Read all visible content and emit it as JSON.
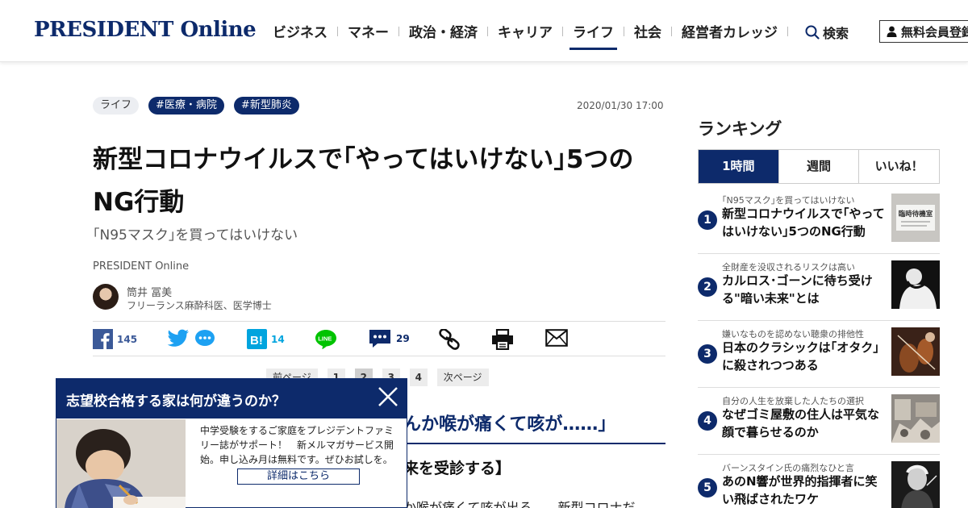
{
  "header": {
    "logo": "PRESIDENT Online",
    "nav": [
      "ビジネス",
      "マネー",
      "政治・経済",
      "キャリア",
      "ライフ",
      "社会",
      "経営者カレッジ"
    ],
    "active_nav": "ライフ",
    "search_label": "検索",
    "member_label": "無料会員登録"
  },
  "article": {
    "tags": [
      "ライフ",
      "#医療・病院",
      "#新型肺炎"
    ],
    "date": "2020/01/30 17:00",
    "title": "新型コロナウイルスで｢やってはいけない｣5つのNG行動",
    "subtitle": "｢N95マスク｣を買ってはいけない",
    "publisher": "PRESIDENT Online",
    "author": {
      "name": "筒井 冨美",
      "role": "フリーランス麻酔科医、医学博士"
    },
    "share": {
      "facebook_count": "145",
      "hatena_count": "14",
      "comment_count": "29"
    },
    "pager": {
      "prev": "前ページ",
      "pages": [
        "1",
        "2",
        "3",
        "4"
      ],
      "current": "2",
      "next": "次ページ"
    },
    "partial_heading": "んか喉が痛くて咳が……」",
    "partial_subheading": "来を受診する】",
    "partial_body": "か喉が痛くて咳が出る……新型コロナだ"
  },
  "popup": {
    "title": "志望校合格する家は何が違うのか？",
    "text": "中学受験をするご家庭をプレジデントファミリー誌がサポート！　新メルマガサービス開始。申し込み月は無料です。ぜひお試しを。",
    "button": "詳細はこちら"
  },
  "ranking": {
    "title": "ランキング",
    "tabs": [
      "1時間",
      "週間",
      "いいね！"
    ],
    "active_tab": "1時間",
    "items": [
      {
        "num": "1",
        "kicker": "｢N95マスク｣を買ってはいけない",
        "headline": "新型コロナウイルスで｢やってはいけない｣5つのNG行動",
        "thumb_label": "臨時待機室"
      },
      {
        "num": "2",
        "kicker": "全財産を没収されるリスクは高い",
        "headline": "カルロス･ゴーンに待ち受ける\"暗い未来\"とは"
      },
      {
        "num": "3",
        "kicker": "嫌いなものを認めない聴衆の排他性",
        "headline": "日本のクラシックは｢オタク｣に殺されつつある"
      },
      {
        "num": "4",
        "kicker": "自分の人生を放棄した人たちの選択",
        "headline": "なぜゴミ屋敷の住人は平気な顔で暮らせるのか"
      },
      {
        "num": "5",
        "kicker": "バーンスタイン氏の痛烈なひと言",
        "headline": "あのN響が世界的指揮者に笑い飛ばされたワケ"
      }
    ]
  },
  "colors": {
    "brand_navy": "#0d2a6b",
    "facebook": "#3b5998",
    "twitter": "#1da1f2",
    "hatena": "#00a4de",
    "line": "#00c300"
  }
}
